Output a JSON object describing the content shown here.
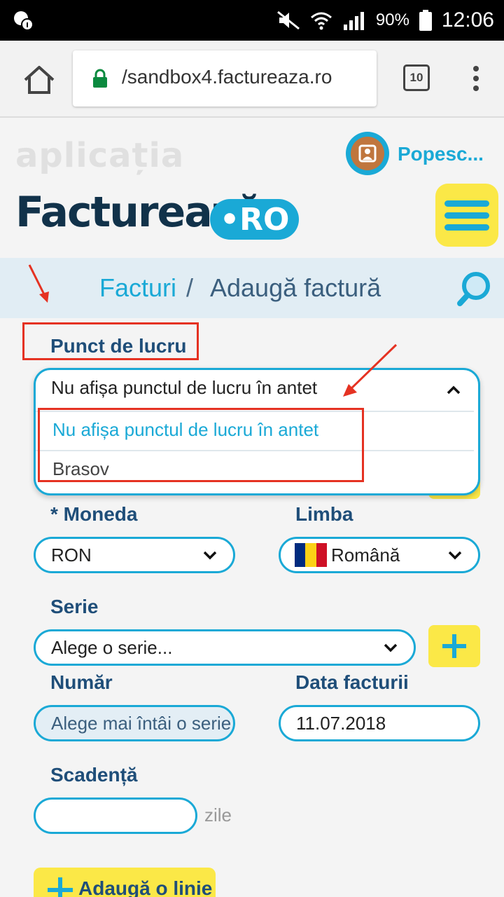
{
  "status_bar": {
    "battery": "90%",
    "time": "12:06"
  },
  "browser": {
    "url": "/sandbox4.factureaza.ro",
    "tab_count": "10"
  },
  "header": {
    "tagline": "aplicația",
    "brand": "Facturează",
    "brand_suffix": "•RO",
    "username": "Popesc..."
  },
  "breadcrumb": {
    "section": "Facturi",
    "separator": "/",
    "current": "Adaugă factură"
  },
  "form": {
    "workpoint": {
      "label": "Punct de lucru",
      "selected": "Nu afișa punctul de lucru în antet",
      "options": [
        "Nu afișa punctul de lucru în antet",
        "Brasov"
      ]
    },
    "currency": {
      "label": "* Moneda",
      "value": "RON"
    },
    "language": {
      "label": "Limba",
      "value": "Română"
    },
    "series": {
      "label": "Serie",
      "placeholder": "Alege o serie..."
    },
    "number": {
      "label": "Număr",
      "placeholder": "Alege mai întâi o serie"
    },
    "invoice_date": {
      "label": "Data facturii",
      "value": "11.07.2018"
    },
    "due": {
      "label": "Scadență",
      "value": "",
      "unit": "zile"
    },
    "add_line": "Adaugă o linie"
  },
  "colors": {
    "accent": "#1aa9d6",
    "highlight": "#fbe847",
    "annotation": "#e53222"
  }
}
